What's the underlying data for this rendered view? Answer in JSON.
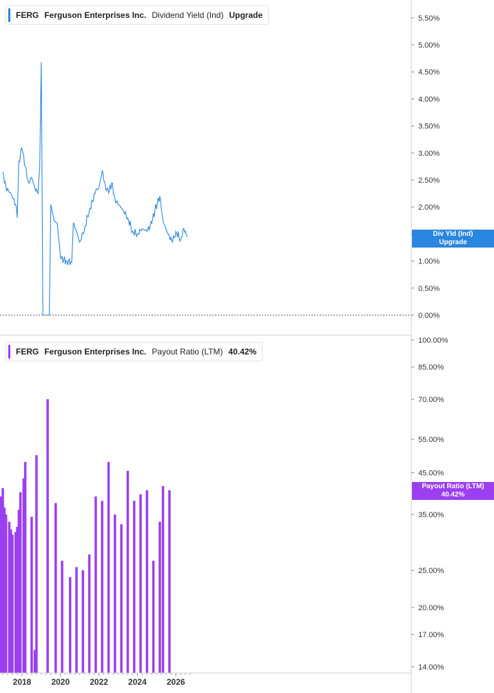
{
  "colors": {
    "dividend_line": "#2a86e0",
    "payout_bars": "#9b3ff0",
    "axis": "#cfcfcf",
    "zero_line": "#555555"
  },
  "legend_top": {
    "ticker": "FERG",
    "company": "Ferguson Enterprises Inc.",
    "metric": "Dividend Yield (Ind)",
    "value": "Upgrade"
  },
  "legend_bottom": {
    "ticker": "FERG",
    "company": "Ferguson Enterprises Inc.",
    "metric": "Payout Ratio (LTM)",
    "value": "40.42%"
  },
  "tag_top": {
    "line1": "Div Yld (Ind)",
    "line2": "Upgrade"
  },
  "tag_bottom": {
    "line1": "Payout Ratio (LTM)",
    "line2": "40.42%"
  },
  "x_tick_labels": [
    "2018",
    "2020",
    "2022",
    "2024",
    "2026"
  ],
  "chart_data": [
    {
      "type": "line",
      "series": [
        {
          "name": "Dividend Yield (Ind)"
        }
      ],
      "y_unit": "%",
      "ylim": [
        0,
        5.8
      ],
      "y_ticks": [
        "0.00%",
        "0.50%",
        "1.00%",
        "1.50%",
        "2.00%",
        "2.50%",
        "3.00%",
        "3.50%",
        "4.00%",
        "4.50%",
        "5.00%",
        "5.50%"
      ],
      "points": [
        [
          "2017-01",
          2.65
        ],
        [
          "2017-03",
          2.35
        ],
        [
          "2017-06",
          2.25
        ],
        [
          "2017-09",
          2.05
        ],
        [
          "2017-10",
          1.8
        ],
        [
          "2017-11",
          2.85
        ],
        [
          "2018-01",
          3.08
        ],
        [
          "2018-03",
          2.75
        ],
        [
          "2018-05",
          2.45
        ],
        [
          "2018-07",
          2.55
        ],
        [
          "2018-09",
          2.35
        ],
        [
          "2018-11",
          2.25
        ],
        [
          "2018-12",
          2.7
        ],
        [
          "2019-01",
          4.68
        ],
        [
          "2019-02",
          0.0
        ],
        [
          "2019-06",
          0.0
        ],
        [
          "2019-07",
          2.05
        ],
        [
          "2019-09",
          1.75
        ],
        [
          "2019-11",
          1.7
        ],
        [
          "2019-12",
          1.4
        ],
        [
          "2020-01",
          1.05
        ],
        [
          "2020-05",
          1.0
        ],
        [
          "2020-08",
          0.98
        ],
        [
          "2020-09",
          1.7
        ],
        [
          "2020-11",
          1.55
        ],
        [
          "2021-01",
          1.35
        ],
        [
          "2021-04",
          1.6
        ],
        [
          "2021-07",
          1.95
        ],
        [
          "2021-09",
          2.1
        ],
        [
          "2021-11",
          2.3
        ],
        [
          "2022-01",
          2.35
        ],
        [
          "2022-03",
          2.67
        ],
        [
          "2022-05",
          2.4
        ],
        [
          "2022-07",
          2.25
        ],
        [
          "2022-09",
          2.45
        ],
        [
          "2022-11",
          2.15
        ],
        [
          "2023-01",
          2.05
        ],
        [
          "2023-04",
          1.95
        ],
        [
          "2023-07",
          1.8
        ],
        [
          "2023-10",
          1.55
        ],
        [
          "2024-01",
          1.5
        ],
        [
          "2024-04",
          1.6
        ],
        [
          "2024-07",
          1.55
        ],
        [
          "2024-10",
          1.7
        ],
        [
          "2024-12",
          1.95
        ],
        [
          "2025-03",
          2.2
        ],
        [
          "2025-05",
          1.75
        ],
        [
          "2025-08",
          1.5
        ],
        [
          "2025-11",
          1.35
        ],
        [
          "2026-01",
          1.55
        ],
        [
          "2026-04",
          1.4
        ],
        [
          "2026-06",
          1.6
        ],
        [
          "2026-08",
          1.45
        ]
      ]
    },
    {
      "type": "bar",
      "series": [
        {
          "name": "Payout Ratio (LTM)"
        }
      ],
      "y_unit": "%",
      "y_scale": "log",
      "ylim": [
        13.6,
        100
      ],
      "y_ticks": [
        "14.00%",
        "17.00%",
        "20.00%",
        "25.00%",
        "35.00%",
        "45.00%",
        "55.00%",
        "70.00%",
        "85.00%",
        "100.00%"
      ],
      "bars": [
        [
          "2016-11",
          37.0
        ],
        [
          "2016-12",
          39.0
        ],
        [
          "2017-01",
          41.0
        ],
        [
          "2017-02",
          36.5
        ],
        [
          "2017-03",
          35.0
        ],
        [
          "2017-05",
          33.5
        ],
        [
          "2017-06",
          32.0
        ],
        [
          "2017-07",
          31.0
        ],
        [
          "2017-09",
          31.5
        ],
        [
          "2017-10",
          32.5
        ],
        [
          "2017-11",
          36.0
        ],
        [
          "2017-12",
          40.0
        ],
        [
          "2018-02",
          43.5
        ],
        [
          "2018-03",
          48.0
        ],
        [
          "2018-07",
          34.5
        ],
        [
          "2018-09",
          15.5
        ],
        [
          "2018-10",
          50.0
        ],
        [
          "2019-05",
          70.0
        ],
        [
          "2019-10",
          37.5
        ],
        [
          "2020-02",
          26.5
        ],
        [
          "2020-07",
          24.0
        ],
        [
          "2020-11",
          25.5
        ],
        [
          "2021-03",
          25.0
        ],
        [
          "2021-07",
          27.5
        ],
        [
          "2021-11",
          39.0
        ],
        [
          "2022-03",
          38.0
        ],
        [
          "2022-07",
          48.0
        ],
        [
          "2022-11",
          35.0
        ],
        [
          "2023-03",
          33.0
        ],
        [
          "2023-07",
          45.5
        ],
        [
          "2023-11",
          38.0
        ],
        [
          "2024-03",
          39.5
        ],
        [
          "2024-07",
          40.5
        ],
        [
          "2024-11",
          26.5
        ],
        [
          "2025-03",
          33.5
        ],
        [
          "2025-05",
          41.5
        ],
        [
          "2025-09",
          40.5
        ]
      ]
    }
  ]
}
